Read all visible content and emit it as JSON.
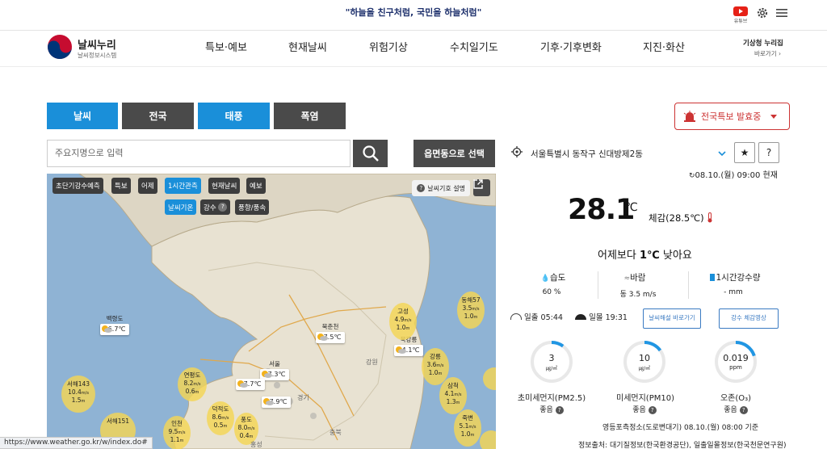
{
  "header": {
    "slogan": "\"하늘을 친구처럼, 국민을 하늘처럼\"",
    "youtube_label": "유튜브",
    "logo_title": "날씨누리",
    "logo_sub": "날씨정보시스템",
    "kma_link": "기상청 누리집",
    "kma_sub": "바로가기 ›"
  },
  "nav": [
    "특보·예보",
    "현재날씨",
    "위험기상",
    "수치일기도",
    "기후·기후변화",
    "지진·화산"
  ],
  "tabs": [
    "날씨",
    "전국",
    "태풍",
    "폭염"
  ],
  "search": {
    "placeholder": "주요지명으로 입력",
    "emd_button": "읍면동으로 선택"
  },
  "map": {
    "chips_row1": [
      "초단기강수예측",
      "특보",
      "어제",
      "1시간관측",
      "현재날씨",
      "예보"
    ],
    "chips_row2": [
      "날씨기온",
      "강수",
      "풍향/풍속"
    ],
    "legend": "날씨기호 설명",
    "cities": [
      {
        "name": "백령도",
        "temp": "26.7℃"
      },
      {
        "name": "북춘천",
        "temp": "27.5℃"
      },
      {
        "name": "북강릉",
        "temp": "24.1℃"
      },
      {
        "name": "서울",
        "temp": "27.3℃"
      },
      {
        "name": "서수도",
        "temp": "27.7℃"
      },
      {
        "name": "풍도",
        "temp": "27.9℃"
      }
    ],
    "bubbles": [
      {
        "name": "동해57",
        "v1": "3.5",
        "u1": "m/s",
        "v2": "1.0",
        "u2": "m"
      },
      {
        "name": "고성",
        "v1": "4.9",
        "u1": "m/s",
        "v2": "1.0",
        "u2": "m"
      },
      {
        "name": "강릉",
        "v1": "3.6",
        "u1": "m/s",
        "v2": "1.0",
        "u2": "m"
      },
      {
        "name": "삼척",
        "v1": "4.1",
        "u1": "m/s",
        "v2": "1.3",
        "u2": "m"
      },
      {
        "name": "죽변",
        "v1": "5.1",
        "u1": "m/s",
        "v2": "1.0",
        "u2": "m"
      },
      {
        "name": "서해143",
        "v1": "10.4",
        "u1": "m/s",
        "v2": "1.5",
        "u2": "m"
      },
      {
        "name": "연평도",
        "v1": "8.2",
        "u1": "m/s",
        "v2": "0.6",
        "u2": "m"
      },
      {
        "name": "덕적도",
        "v1": "8.6",
        "u1": "m/s",
        "v2": "0.5",
        "u2": "m"
      },
      {
        "name": "풍도",
        "v1": "8.0",
        "u1": "m/s",
        "v2": "0.4",
        "u2": "m"
      },
      {
        "name": "서해151",
        "v1": "",
        "u1": "",
        "v2": "",
        "u2": ""
      },
      {
        "name": "인천",
        "v1": "9.5",
        "u1": "m/s",
        "v2": "1.1",
        "u2": "m"
      }
    ],
    "places": [
      "강원",
      "경기",
      "충북",
      "홍성"
    ]
  },
  "panel": {
    "alert": "전국특보 발효중",
    "location": "서울특별시 동작구 신대방제2동",
    "obs_time": "08.10.(월) 09:00 현재",
    "temp": "28.1",
    "temp_unit": "℃",
    "feel": "체감(28.5℃)",
    "compare_prefix": "어제보다 ",
    "compare_bold": "1℃",
    "compare_suffix": " 낮아요",
    "humidity_label": "습도",
    "humidity_value": "60 %",
    "wind_label": "바람",
    "wind_value": "동 3.5 m/s",
    "rain_label": "1시간강수량",
    "rain_value": "- mm",
    "sunrise_label": "일출",
    "sunrise": "05:44",
    "sunset_label": "일몰",
    "sunset": "19:31",
    "btn_weather_comment": "날씨해설 바로가기",
    "btn_rain_video": "강수 체감영상",
    "air": [
      {
        "value": "3",
        "unit": "㎍/㎥",
        "label": "초미세먼지(PM2.5)",
        "status": "좋음",
        "fraction": 0.1
      },
      {
        "value": "10",
        "unit": "㎍/㎥",
        "label": "미세먼지(PM10)",
        "status": "좋음",
        "fraction": 0.15
      },
      {
        "value": "0.019",
        "unit": "ppm",
        "label": "오존(O₃)",
        "status": "좋음",
        "fraction": 0.2
      }
    ],
    "station": "영등포측정소(도로변대기) 08.10.(월) 08:00 기준",
    "source": "정보출처: 대기질정보(한국환경공단), 일출일몰정보(한국천문연구원)"
  },
  "status_url": "https://www.weather.go.kr/w/index.do#",
  "colors": {
    "primary_blue": "#1a8fd9",
    "dark_tab": "#4a4a4a",
    "alert_red": "#cc3333",
    "gauge_blue": "#2196e3"
  }
}
